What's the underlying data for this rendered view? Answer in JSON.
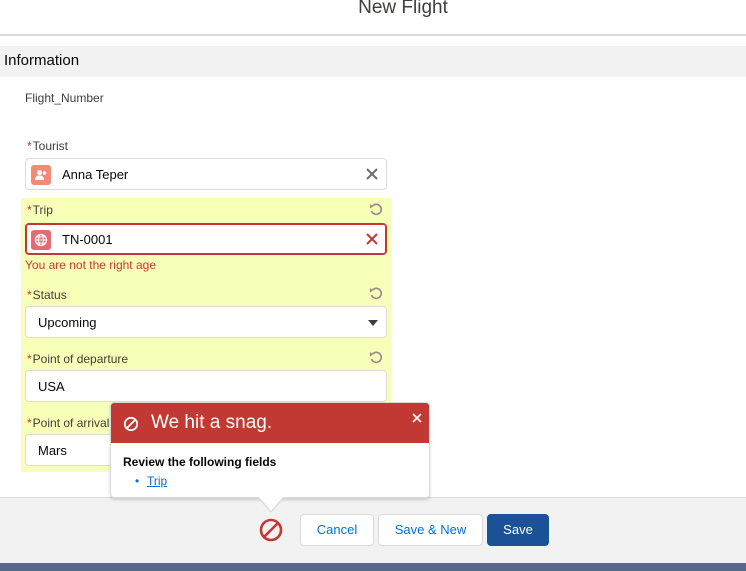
{
  "modal": {
    "title": "New Flight"
  },
  "section": {
    "title": "Information"
  },
  "fields": {
    "flight_number": {
      "label": "Flight_Number"
    },
    "tourist": {
      "label": "Tourist",
      "required": "*",
      "value": "Anna Teper",
      "icon": "user-icon"
    },
    "trip": {
      "label": "Trip",
      "required": "*",
      "value": "TN-0001",
      "icon": "globe-icon",
      "error": "You are not the right age"
    },
    "status": {
      "label": "Status",
      "required": "*",
      "value": "Upcoming"
    },
    "departure": {
      "label": "Point of departure",
      "required": "*",
      "value": "USA"
    },
    "arrival": {
      "label": "Point of arrival",
      "required": "*",
      "value": "Mars"
    }
  },
  "error_popover": {
    "title": "We hit a snag.",
    "subtitle": "Review the following fields",
    "fields": [
      "Trip"
    ]
  },
  "footer": {
    "cancel_label": "Cancel",
    "save_new_label": "Save & New",
    "save_label": "Save"
  },
  "colors": {
    "error": "#c23934",
    "highlight": "#f8ffb6",
    "brand": "#1b5297",
    "link": "#0070d2"
  }
}
